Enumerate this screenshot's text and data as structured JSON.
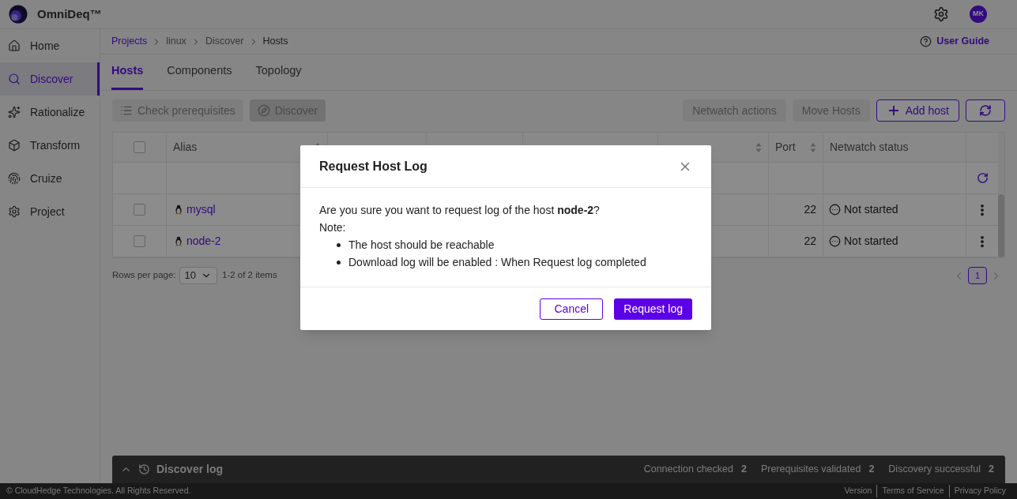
{
  "app": {
    "name": "OmniDeq™",
    "avatar": "MK"
  },
  "sidebar": {
    "items": [
      {
        "label": "Home",
        "selected": false
      },
      {
        "label": "Discover",
        "selected": true
      },
      {
        "label": "Rationalize",
        "selected": false
      },
      {
        "label": "Transform",
        "selected": false
      },
      {
        "label": "Cruize",
        "selected": false
      },
      {
        "label": "Project",
        "selected": false
      }
    ]
  },
  "breadcrumb": [
    {
      "label": "Projects",
      "kind": "link"
    },
    {
      "label": "linux",
      "kind": "muted"
    },
    {
      "label": "Discover",
      "kind": "muted"
    },
    {
      "label": "Hosts",
      "kind": "current"
    }
  ],
  "user_guide": "User Guide",
  "tabs": [
    {
      "label": "Hosts",
      "selected": true
    },
    {
      "label": "Components",
      "selected": false
    },
    {
      "label": "Topology",
      "selected": false
    }
  ],
  "toolbar": {
    "left": [
      {
        "label": "Check prerequisites",
        "disabled": true
      },
      {
        "label": "Discover",
        "disabled": true
      }
    ],
    "right": [
      {
        "label": "Netwatch actions",
        "disabled": true
      },
      {
        "label": "Move Hosts",
        "disabled": true
      },
      {
        "label": "Add host",
        "disabled": false
      }
    ]
  },
  "table": {
    "select_all": {
      "checked": false
    },
    "columns": [
      {
        "label": "Alias",
        "sortable": true
      },
      {
        "label": "Port",
        "sortable": true
      },
      {
        "label": "Netwatch status",
        "sortable": false
      }
    ],
    "rows": [
      {
        "checked": false,
        "alias": "mysql",
        "port": "22",
        "netwatch_status": "Not started"
      },
      {
        "checked": false,
        "alias": "node-2",
        "port": "22",
        "netwatch_status": "Not started"
      }
    ]
  },
  "pagination": {
    "rows_per_page_label": "Rows per page:",
    "rows_per_page": "10",
    "range": "1-2 of 2 items",
    "pages": [
      {
        "label": "1",
        "selected": true
      }
    ]
  },
  "discover_log": {
    "title": "Discover log",
    "stats": [
      {
        "label": "Connection checked",
        "value": "2"
      },
      {
        "label": "Prerequisites validated",
        "value": "2"
      },
      {
        "label": "Discovery successful",
        "value": "2"
      }
    ]
  },
  "footer": {
    "copyright": "© CloudHedge Technologies. All Rights Reserved.",
    "links": [
      "Version",
      "Terms of Service",
      "Privacy Policy"
    ]
  },
  "modal": {
    "title": "Request Host Log",
    "message": "Are you sure you want to request log of the host **node-2**?",
    "note": "Note:",
    "bullets": [
      "The host should be reachable",
      "Download log will be enabled : When Request log completed"
    ],
    "buttons": [
      {
        "label": "Cancel",
        "kind": "secondary"
      },
      {
        "label": "Request log",
        "kind": "primary"
      }
    ]
  }
}
